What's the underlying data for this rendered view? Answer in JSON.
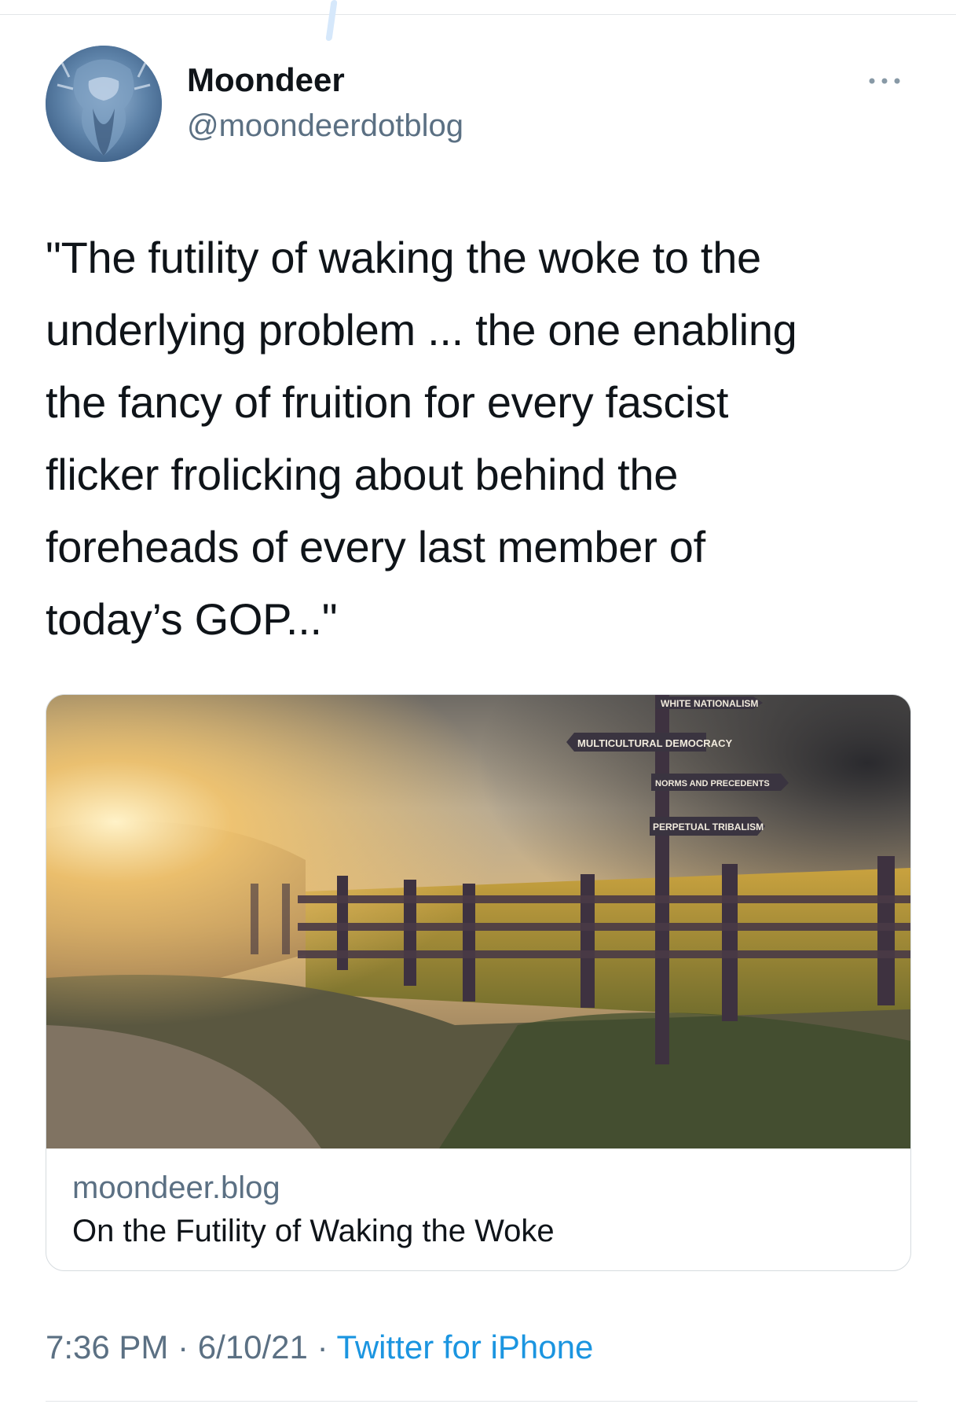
{
  "tweet": {
    "author_name": "Moondeer",
    "author_handle": "@moondeerdotblog",
    "text": "\"The futility of waking the woke to the\nunderlying problem ... the one enabling\nthe fancy of fruition for every fascist\nflicker frolicking about behind the\nforeheads of every last member of\ntoday’s GOP...\""
  },
  "card": {
    "image_signs": [
      "WHITE NATIONALISM",
      "MULTICULTURAL DEMOCRACY",
      "NORMS AND PRECEDENTS",
      "PERPETUAL TRIBALISM"
    ],
    "domain": "moondeer.blog",
    "title": "On the Futility of Waking the Woke"
  },
  "meta": {
    "time": "7:36 PM",
    "separator": "·",
    "date": "6/10/21",
    "source": "Twitter for iPhone"
  },
  "icons": {
    "more": "more-horizontal-icon",
    "avatar": "avatar-image"
  },
  "colors": {
    "text_primary": "#0f1419",
    "text_secondary": "#5b7083",
    "link": "#1b95e0",
    "border": "#d6dbdf"
  }
}
